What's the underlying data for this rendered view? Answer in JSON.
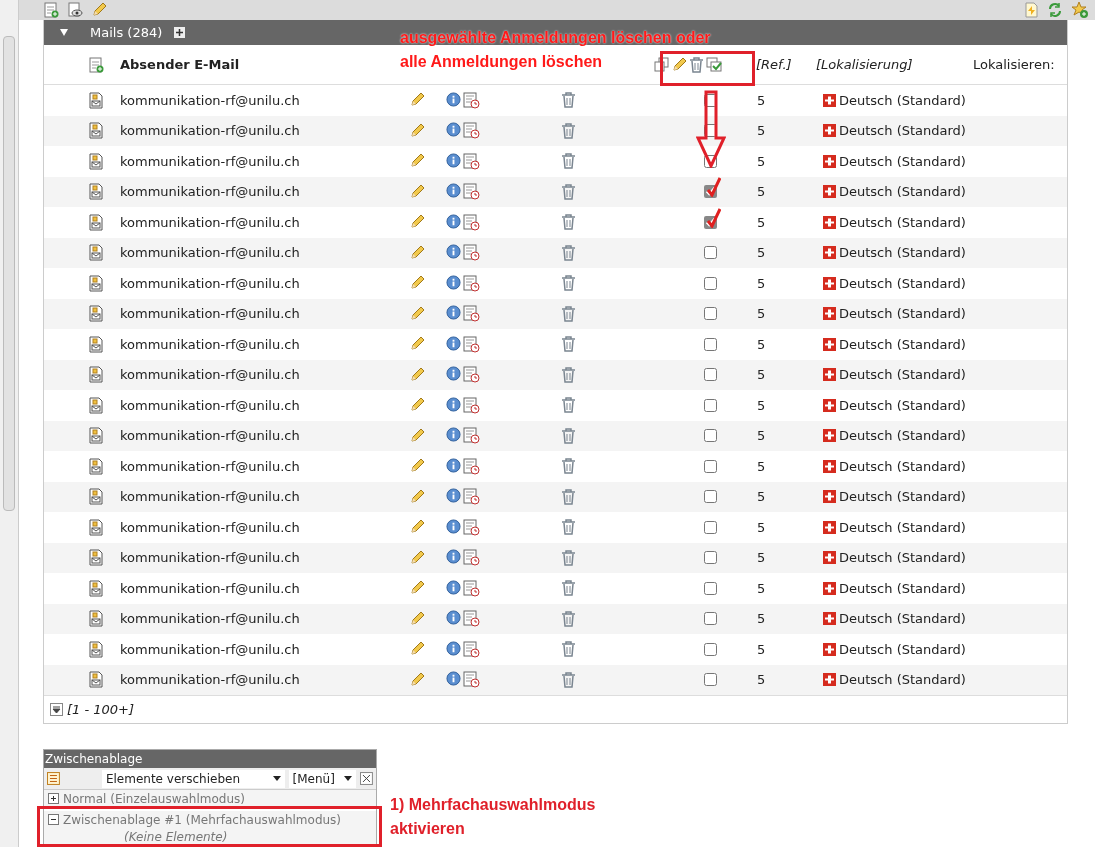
{
  "table": {
    "title": "Mails (284)",
    "columns": [
      "Absender E-Mail",
      "[Ref.]",
      "[Lokalisierung]",
      "Lokalisieren:"
    ],
    "rows": [
      {
        "email": "kommunikation-rf@unilu.ch",
        "checked": false,
        "ref": "5",
        "language": "Deutsch (Standard)"
      },
      {
        "email": "kommunikation-rf@unilu.ch",
        "checked": false,
        "ref": "5",
        "language": "Deutsch (Standard)"
      },
      {
        "email": "kommunikation-rf@unilu.ch",
        "checked": false,
        "ref": "5",
        "language": "Deutsch (Standard)"
      },
      {
        "email": "kommunikation-rf@unilu.ch",
        "checked": true,
        "ref": "5",
        "language": "Deutsch (Standard)"
      },
      {
        "email": "kommunikation-rf@unilu.ch",
        "checked": true,
        "ref": "5",
        "language": "Deutsch (Standard)"
      },
      {
        "email": "kommunikation-rf@unilu.ch",
        "checked": false,
        "ref": "5",
        "language": "Deutsch (Standard)"
      },
      {
        "email": "kommunikation-rf@unilu.ch",
        "checked": false,
        "ref": "5",
        "language": "Deutsch (Standard)"
      },
      {
        "email": "kommunikation-rf@unilu.ch",
        "checked": false,
        "ref": "5",
        "language": "Deutsch (Standard)"
      },
      {
        "email": "kommunikation-rf@unilu.ch",
        "checked": false,
        "ref": "5",
        "language": "Deutsch (Standard)"
      },
      {
        "email": "kommunikation-rf@unilu.ch",
        "checked": false,
        "ref": "5",
        "language": "Deutsch (Standard)"
      },
      {
        "email": "kommunikation-rf@unilu.ch",
        "checked": false,
        "ref": "5",
        "language": "Deutsch (Standard)"
      },
      {
        "email": "kommunikation-rf@unilu.ch",
        "checked": false,
        "ref": "5",
        "language": "Deutsch (Standard)"
      },
      {
        "email": "kommunikation-rf@unilu.ch",
        "checked": false,
        "ref": "5",
        "language": "Deutsch (Standard)"
      },
      {
        "email": "kommunikation-rf@unilu.ch",
        "checked": false,
        "ref": "5",
        "language": "Deutsch (Standard)"
      },
      {
        "email": "kommunikation-rf@unilu.ch",
        "checked": false,
        "ref": "5",
        "language": "Deutsch (Standard)"
      },
      {
        "email": "kommunikation-rf@unilu.ch",
        "checked": false,
        "ref": "5",
        "language": "Deutsch (Standard)"
      },
      {
        "email": "kommunikation-rf@unilu.ch",
        "checked": false,
        "ref": "5",
        "language": "Deutsch (Standard)"
      },
      {
        "email": "kommunikation-rf@unilu.ch",
        "checked": false,
        "ref": "5",
        "language": "Deutsch (Standard)"
      },
      {
        "email": "kommunikation-rf@unilu.ch",
        "checked": false,
        "ref": "5",
        "language": "Deutsch (Standard)"
      },
      {
        "email": "kommunikation-rf@unilu.ch",
        "checked": false,
        "ref": "5",
        "language": "Deutsch (Standard)"
      }
    ],
    "pager": "[1 - 100+]"
  },
  "clipboard": {
    "title": "Zwischenablage",
    "action": "Elemente verschieben",
    "menu": "[Menü]",
    "modes": [
      {
        "label": "Normal (Einzelauswahlmodus)",
        "expanded": false
      },
      {
        "label": "Zwischenablage #1 (Mehrfachauswahlmodus)",
        "expanded": true
      }
    ],
    "empty_note": "(Keine Elemente)"
  },
  "annotations": [
    {
      "lines": [
        "ausgewählte Anmeldungen löschen oder",
        "alle Anmeldungen löschen"
      ]
    },
    {
      "lines": [
        "1) Mehrfachauswahlmodus",
        "aktivieren"
      ]
    }
  ]
}
